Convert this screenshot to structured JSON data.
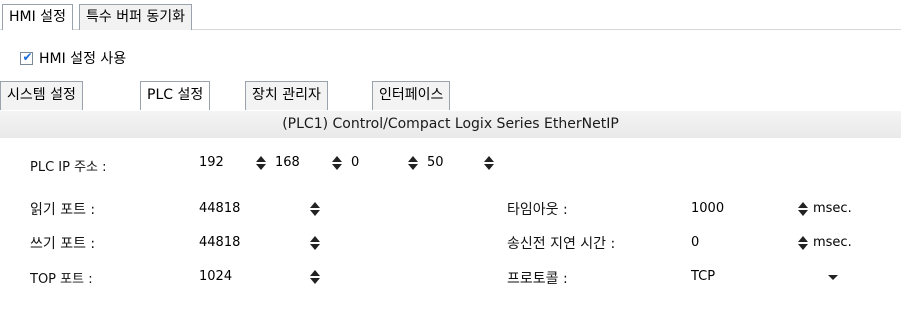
{
  "top_tabs": [
    {
      "label": "HMI 설정",
      "active": true
    },
    {
      "label": "특수 버퍼 동기화",
      "active": false
    }
  ],
  "hmi_settings_enable": {
    "label": "HMI 설정 사용",
    "checked": true
  },
  "sub_tabs": [
    {
      "label": "시스템 설정",
      "active": false
    },
    {
      "label": "PLC 설정",
      "active": true
    },
    {
      "label": "장치 관리자",
      "active": false
    },
    {
      "label": "인터페이스",
      "active": false
    }
  ],
  "panel": {
    "title": "(PLC1) Control/Compact Logix Series EtherNetIP",
    "plc_ip": {
      "label": "PLC IP 주소 :",
      "octets": [
        "192",
        "168",
        "0",
        "50"
      ]
    },
    "read_port": {
      "label": "읽기 포트 :",
      "value": "44818"
    },
    "write_port": {
      "label": "쓰기 포트 :",
      "value": "44818"
    },
    "top_port": {
      "label": "TOP 포트 :",
      "value": "1024"
    },
    "timeout": {
      "label": "타임아웃 :",
      "value": "1000",
      "unit": "msec."
    },
    "send_delay": {
      "label": "송신전 지연 시간 :",
      "value": "0",
      "unit": "msec."
    },
    "protocol": {
      "label": "프로토콜 :",
      "value": "TCP"
    }
  },
  "colors": {
    "tab_border": "#9aa3ad",
    "check_mark": "#1a6ed8",
    "panel_title_bg": "#eeeeee"
  }
}
